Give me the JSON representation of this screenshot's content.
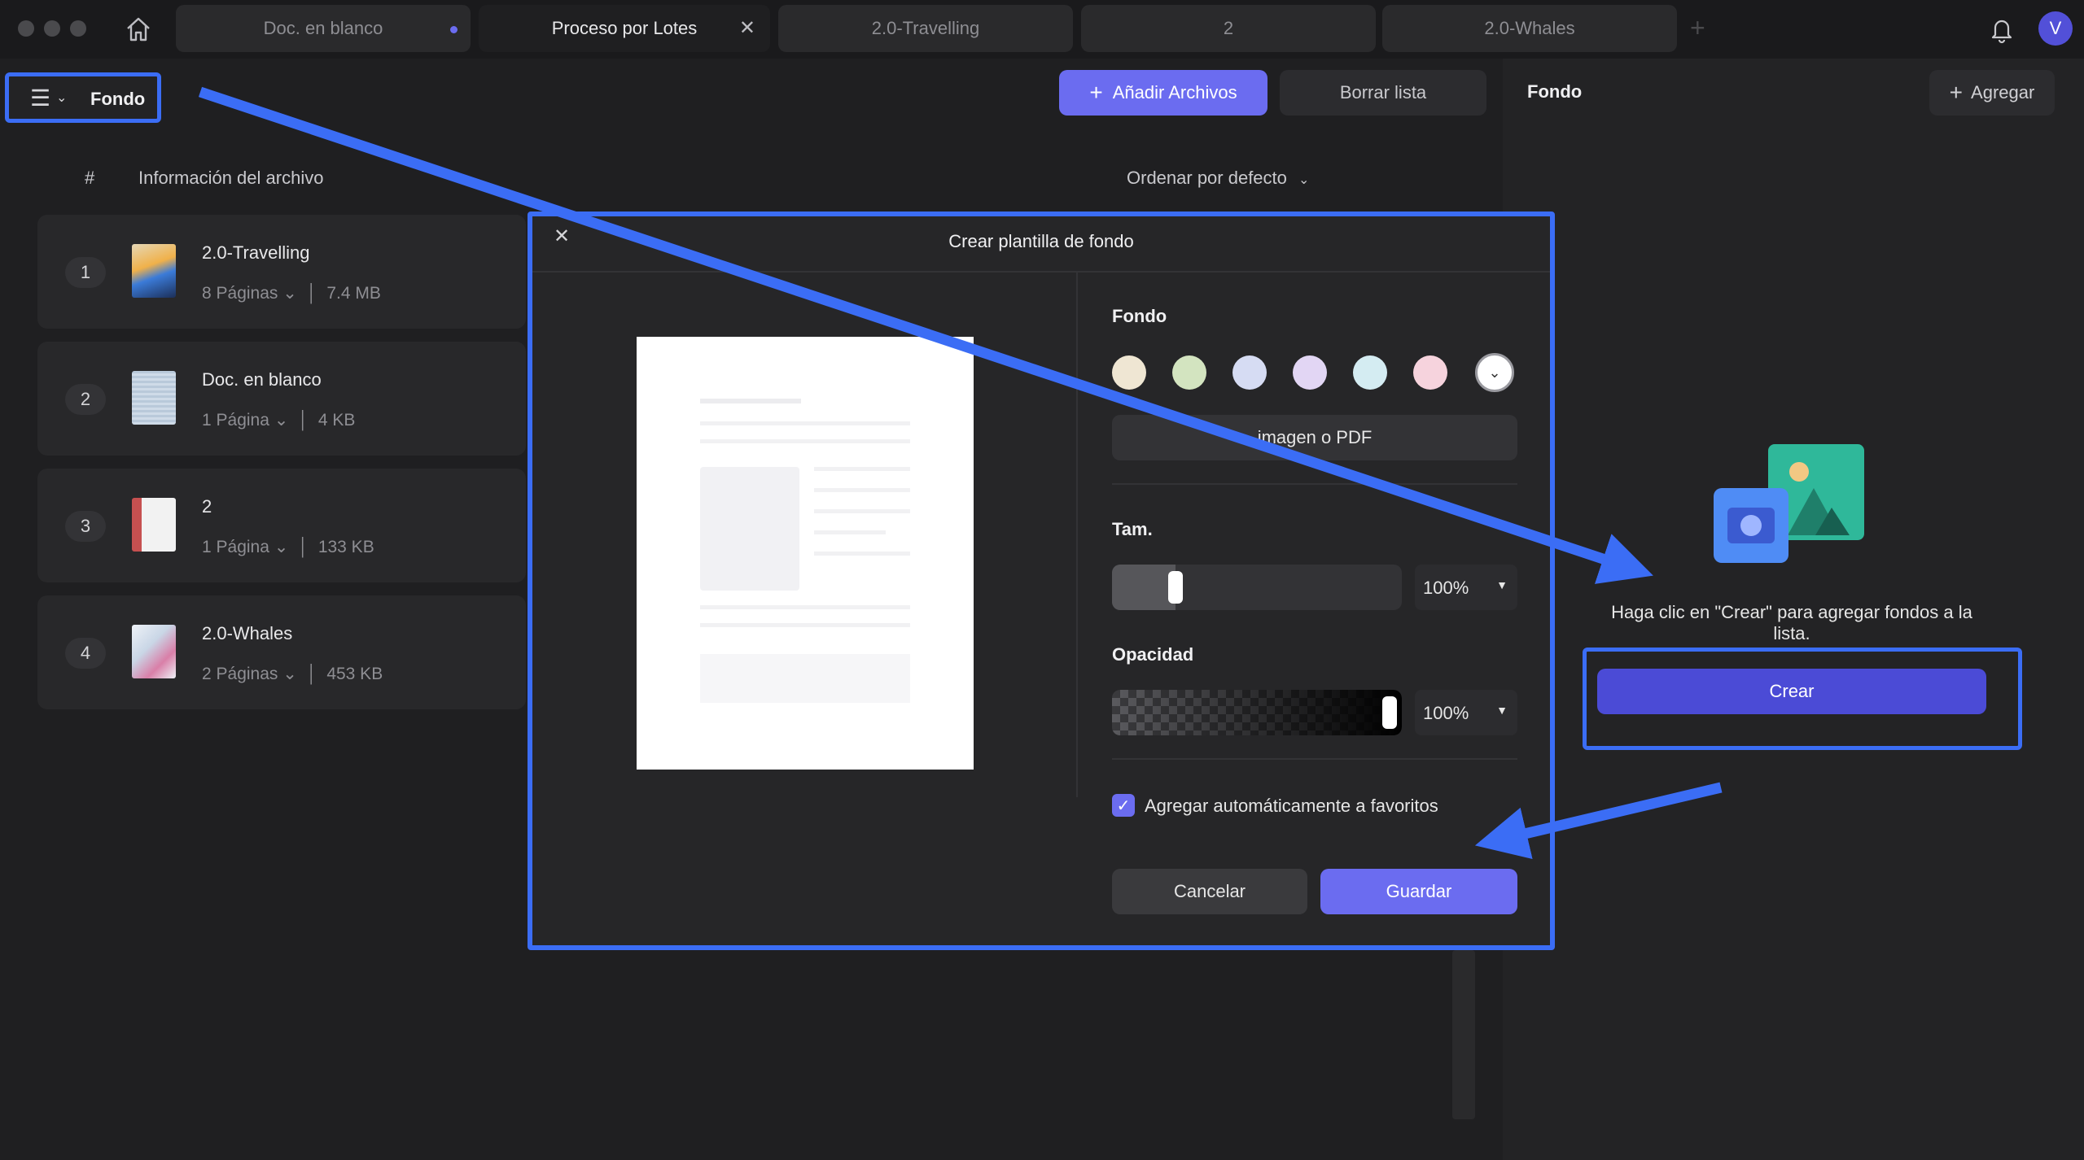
{
  "window": {
    "tabs": [
      {
        "label": "Doc. en blanco"
      },
      {
        "label": "Proceso por Lotes"
      },
      {
        "label": "2.0-Travelling"
      },
      {
        "label": "2"
      },
      {
        "label": "2.0-Whales"
      }
    ],
    "avatar_letter": "V"
  },
  "toolbar": {
    "section_title": "Fondo",
    "add_files_label": "Añadir Archivos",
    "clear_list_label": "Borrar lista"
  },
  "file_list": {
    "col_number": "#",
    "col_info": "Información del archivo",
    "sort_label": "Ordenar por defecto",
    "files": [
      {
        "index": "1",
        "name": "2.0-Travelling",
        "pages": "8 Páginas",
        "size": "7.4 MB"
      },
      {
        "index": "2",
        "name": "Doc. en blanco",
        "pages": "1 Página",
        "size": "4 KB"
      },
      {
        "index": "3",
        "name": "2",
        "pages": "1 Página",
        "size": "133 KB"
      },
      {
        "index": "4",
        "name": "2.0-Whales",
        "pages": "2 Páginas",
        "size": "453 KB"
      }
    ]
  },
  "right_panel": {
    "title": "Fondo",
    "add_label": "Agregar",
    "empty_hint": "Haga clic en \"Crear\" para agregar fondos a la lista.",
    "create_label": "Crear"
  },
  "modal": {
    "title": "Crear plantilla de fondo",
    "background_label": "Fondo",
    "swatches": [
      "#efe6d3",
      "#d3e4c0",
      "#d6dcf3",
      "#e2d6f4",
      "#d4ecf2",
      "#f6d3dd"
    ],
    "image_pdf_label": "imagen o PDF",
    "size_label": "Tam.",
    "size_value": "100%",
    "size_fraction": 0.22,
    "opacity_label": "Opacidad",
    "opacity_value": "100%",
    "opacity_fraction": 1.0,
    "favorites_label": "Agregar automáticamente a favoritos",
    "favorites_checked": true,
    "cancel_label": "Cancelar",
    "save_label": "Guardar"
  },
  "colors": {
    "accent": "#6b6cf0",
    "highlight": "#3b6df5",
    "create_button": "#4b4bd6"
  }
}
